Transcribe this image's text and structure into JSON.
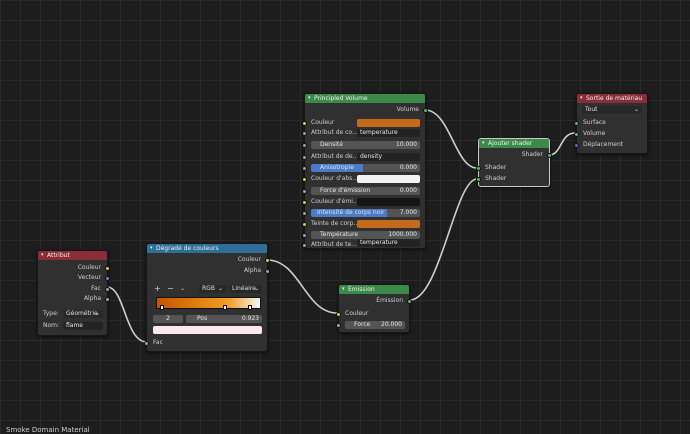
{
  "colors": {
    "grid": "#2a2a2a",
    "background": "#1d1d1d",
    "header_green": "#3c8a4a",
    "header_red": "#8a2d36",
    "header_blue": "#2e6f97",
    "orange_swatch": "#c46a1a"
  },
  "principled": {
    "title": "Principled Volume",
    "out_volume": "Volume",
    "couleur": "Couleur",
    "attr_couleur": "Attribut de co...",
    "attr_couleur_val": "temperature",
    "densite": "Densité",
    "densite_val": "10.000",
    "attr_densite": "Attribut de de...",
    "attr_densite_val": "density",
    "anisotropie": "Anisotropie",
    "anisotropie_val": "0.000",
    "couleur_abs": "Couleur d'abs...",
    "force_emission": "Force d'émission",
    "force_emission_val": "0.000",
    "couleur_emi": "Couleur d'émi...",
    "intensite": "Intensité de corps noir",
    "intensite_val": "7.000",
    "teinte": "Teinte de corp...",
    "temperature": "Température",
    "temperature_val": "1000.000",
    "attr_temp": "Attribut de te...",
    "attr_temp_val": "temperature"
  },
  "sortie": {
    "title": "Sortie de matériau",
    "target": "Tout",
    "surface": "Surface",
    "volume": "Volume",
    "deplacement": "Déplacement"
  },
  "ajouter": {
    "title": "Ajouter shader",
    "out_shader": "Shader",
    "in_shader1": "Shader",
    "in_shader2": "Shader"
  },
  "attribut": {
    "title": "Attribut",
    "out_couleur": "Couleur",
    "out_vecteur": "Vecteur",
    "out_fac": "Fac",
    "out_alpha": "Alpha",
    "type_label": "Type:",
    "type_val": "Géométrie",
    "nom_label": "Nom:",
    "nom_val": "flame"
  },
  "degrade": {
    "title": "Dégradé de couleurs",
    "out_couleur": "Couleur",
    "out_alpha": "Alpha",
    "plus": "+",
    "minus": "−",
    "color_mode": "RGB",
    "interp": "Linéaire",
    "stop_index": "2",
    "pos_label": "Pos",
    "pos_val": "0.923",
    "in_fac": "Fac"
  },
  "emission": {
    "title": "Émission",
    "out_emission": "Émission",
    "couleur": "Couleur",
    "force": "Force",
    "force_val": "20.000"
  },
  "status": {
    "text": "Smoke Domain Material"
  }
}
